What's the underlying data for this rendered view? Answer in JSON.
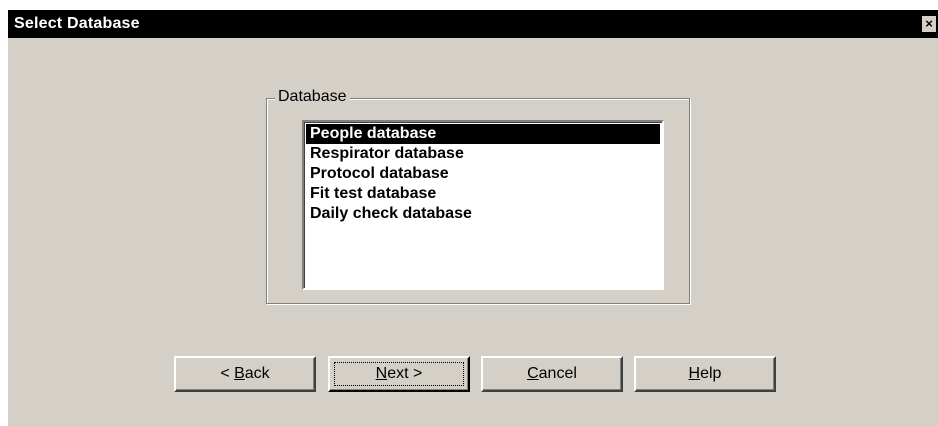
{
  "window": {
    "title": "Select Database",
    "close_glyph": "×"
  },
  "group": {
    "label": "Database"
  },
  "list": {
    "items": [
      "People database",
      "Respirator database",
      "Protocol database",
      "Fit test database",
      "Daily check database"
    ],
    "selected_index": 0
  },
  "buttons": {
    "back": {
      "prefix": "< ",
      "mnemonic": "B",
      "rest": "ack"
    },
    "next": {
      "prefix": "",
      "mnemonic": "N",
      "rest": "ext >"
    },
    "cancel": {
      "prefix": "",
      "mnemonic": "C",
      "rest": "ancel"
    },
    "help": {
      "prefix": "",
      "mnemonic": "H",
      "rest": "elp"
    }
  },
  "colors": {
    "face": "#d4d0c8",
    "titlebar": "#000000",
    "selection": "#000000"
  }
}
